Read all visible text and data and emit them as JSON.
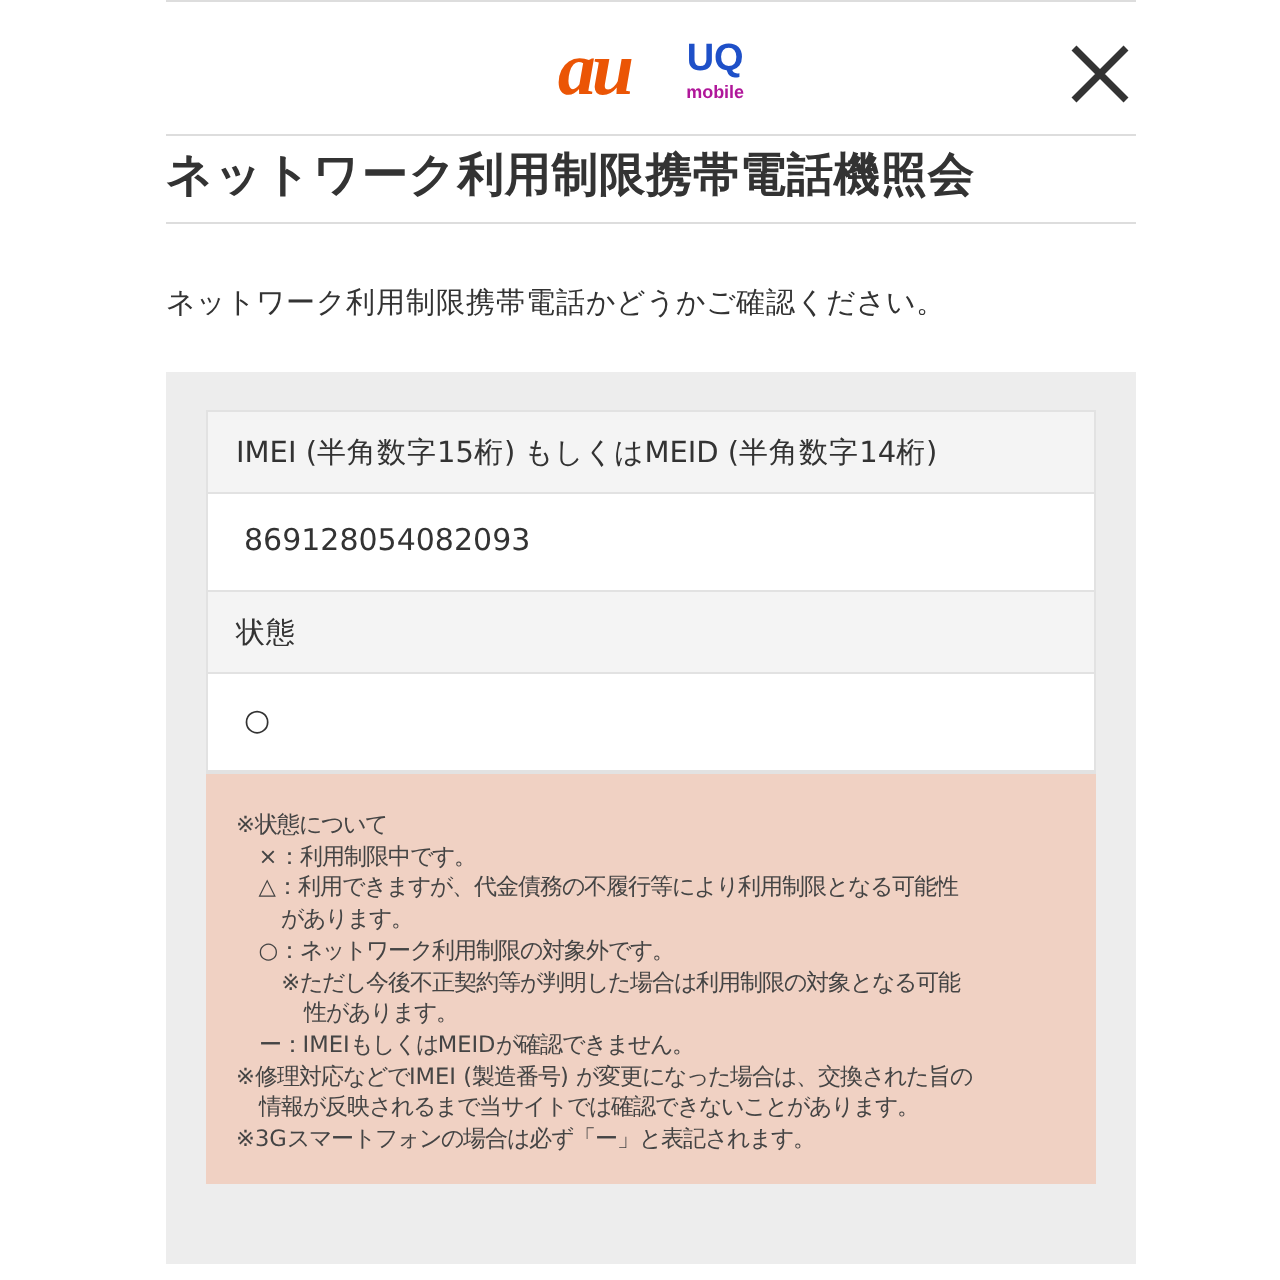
{
  "header": {
    "logos": [
      {
        "kind": "au",
        "text": "au"
      },
      {
        "kind": "uq",
        "text": "UQ",
        "subtext": "mobile"
      }
    ]
  },
  "title": "ネットワーク利用制限携帯電話機照会",
  "description": "ネットワーク利用制限携帯電話かどうかご確認ください。",
  "result": {
    "fields": [
      {
        "label": "IMEI (半角数字15桁) もしくはMEID (半角数字14桁)",
        "value": "869128054082093"
      },
      {
        "label": "状態",
        "value": "○"
      }
    ],
    "notes": [
      {
        "lines": [
          "※状態について"
        ],
        "children": [
          {
            "lines": [
              "×：利用制限中です。"
            ]
          },
          {
            "lines": [
              "△：利用できますが、代金債務の不履行等により利用制限となる可能性",
              "があります。"
            ]
          },
          {
            "lines": [
              "○：ネットワーク利用制限の対象外です。"
            ],
            "children": [
              {
                "lines": [
                  "※ただし今後不正契約等が判明した場合は利用制限の対象となる可能",
                  "性があります。"
                ]
              }
            ]
          },
          {
            "lines": [
              "ー：IMEIもしくはMEIDが確認できません。"
            ]
          }
        ]
      },
      {
        "lines": [
          "※修理対応などでIMEI (製造番号) が変更になった場合は、交換された旨の",
          "情報が反映されるまで当サイトでは確認できないことがあります。"
        ]
      },
      {
        "lines": [
          "※3Gスマートフォンの場合は必ず「ー」と表記されます。"
        ]
      }
    ]
  }
}
